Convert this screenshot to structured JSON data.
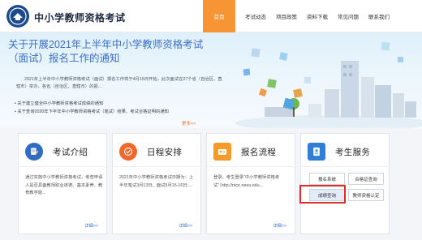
{
  "header": {
    "site_title": "中小学教师资格考试",
    "nav": [
      "首页",
      "考试动态",
      "项目政策",
      "资料下载",
      "常见问题",
      "联系我们"
    ],
    "active_nav_index": 0
  },
  "hero": {
    "title": "关于开展2021年上半年中小学教师资格考试（面试）报名工作的通知",
    "description": "2021年上半年中小学教师资格考试（面试）报名工作将于4月15日开始，此次面试在27个省（自治区、直辖市）举办，各省（自治区、直辖市）的报...",
    "links": [
      "关于建立健全中小学教师资格考试成绩的通知",
      "关于查询2020年下半年中小学教师资格考试（笔试）结果、考试合格证明的通知"
    ],
    "more": "更多>>"
  },
  "cards": [
    {
      "title": "考试介绍",
      "icon": "document-pen-icon",
      "icon_color": "#2f6dc4",
      "text": "通过实施中小学教师资格考试，考查申请人是否具备教师职业道德、基本素养、教育教学能...",
      "more": "详细>>"
    },
    {
      "title": "日程安排",
      "icon": "check-circle-icon",
      "icon_color": "#f0692c",
      "text": "2021年中小学教师资格考试日期为：上半年笔试3月13日，面试5月15-16日;...",
      "more": "详细>>"
    },
    {
      "title": "报名流程",
      "icon": "id-card-icon",
      "icon_color": "#f39a2a",
      "text": "登录。考生登录“中小学教师资格考试”（http://ntce.neea.edu...",
      "more": "详细>>"
    },
    {
      "title": "考生服务",
      "icon": "person-badge-icon",
      "icon_color": "#2f7fd6",
      "buttons": [
        "报名系统",
        "合格证查询",
        "成绩查询",
        "教师资格认定"
      ]
    }
  ]
}
